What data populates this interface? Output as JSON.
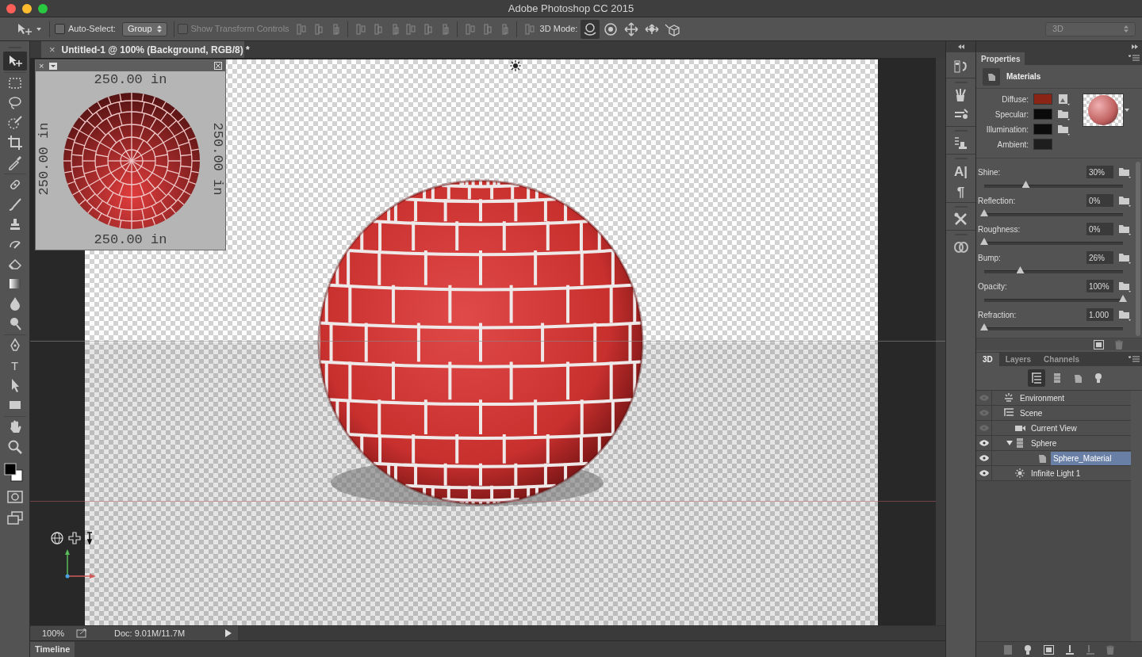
{
  "window": {
    "title": "Adobe Photoshop CC 2015"
  },
  "options_bar": {
    "auto_select": {
      "label": "Auto-Select:",
      "checked": false
    },
    "group_dropdown": {
      "value": "Group"
    },
    "show_transform": {
      "label": "Show Transform Controls",
      "checked": false,
      "disabled": true
    },
    "mode_label": "3D Mode:",
    "mode_tools": [
      {
        "selected": true
      },
      {
        "selected": false
      },
      {
        "selected": false
      },
      {
        "selected": false
      },
      {
        "selected": false
      }
    ],
    "workspace": {
      "value": "3D"
    }
  },
  "document_tab": {
    "close": "×",
    "title": "Untitled-1 @ 100% (Background, RGB/8) *"
  },
  "tools": [
    {
      "selected": true
    },
    {
      "selected": false
    },
    {
      "selected": false
    },
    {
      "selected": false
    },
    {
      "selected": false
    },
    {
      "selected": false
    },
    {
      "selected": false
    },
    {
      "selected": false
    },
    {
      "selected": false
    },
    {
      "selected": false
    },
    {
      "selected": false
    },
    {
      "selected": false
    },
    {
      "selected": false
    },
    {
      "selected": false
    },
    {
      "selected": false
    },
    {
      "selected": false,
      "glyph": "T"
    },
    {
      "selected": false
    },
    {
      "selected": false
    },
    {
      "selected": false
    },
    {
      "selected": false
    }
  ],
  "uv_overlay": {
    "close": "×",
    "labels": [
      "250.00 in",
      "250.00 in",
      "250.00 in",
      "250.00 in"
    ]
  },
  "status_bar": {
    "zoom": "100%",
    "doc": "Doc: 9.01M/11.7M"
  },
  "timeline": {
    "label": "Timeline"
  },
  "icon_strip": [
    "A|",
    "¶"
  ],
  "properties": {
    "tab": "Properties",
    "section": "Materials",
    "swatches": [
      {
        "label": "Diffuse:",
        "color": "#8a2516",
        "kind": "texture"
      },
      {
        "label": "Specular:",
        "color": "#0a0a0a",
        "kind": "folder"
      },
      {
        "label": "Illumination:",
        "color": "#0c0c0c",
        "kind": "folder"
      },
      {
        "label": "Ambient:",
        "color": "#1e1e1e",
        "kind": "plain"
      }
    ],
    "sliders": [
      {
        "label": "Shine:",
        "value": "30%",
        "level": 0.3
      },
      {
        "label": "Reflection:",
        "value": "0%",
        "level": 0
      },
      {
        "label": "Roughness:",
        "value": "0%",
        "level": 0
      },
      {
        "label": "Bump:",
        "value": "26%",
        "level": 0.26
      },
      {
        "label": "Opacity:",
        "value": "100%",
        "level": 1
      },
      {
        "label": "Refraction:",
        "value": "1.000",
        "level": 0
      }
    ]
  },
  "scene_panel": {
    "tabs": [
      {
        "label": "3D",
        "selected": true
      },
      {
        "label": "Layers",
        "selected": false
      },
      {
        "label": "Channels",
        "selected": false
      }
    ],
    "filters": [
      {
        "selected": true
      },
      {
        "selected": false
      },
      {
        "selected": false
      },
      {
        "selected": false
      }
    ],
    "items": [
      {
        "label": "Environment",
        "kind": "environment",
        "visible": false,
        "selected": false
      },
      {
        "label": "Scene",
        "kind": "scene",
        "visible": false,
        "selected": false,
        "children": [
          {
            "label": "Current View",
            "kind": "camera",
            "visible": false,
            "selected": false
          },
          {
            "label": "Sphere",
            "kind": "mesh",
            "visible": true,
            "selected": false,
            "expanded": true,
            "children": [
              {
                "label": "Sphere_Material",
                "kind": "material",
                "visible": true,
                "selected": true
              }
            ]
          },
          {
            "label": "Infinite Light 1",
            "kind": "light",
            "visible": true,
            "selected": false
          }
        ]
      }
    ]
  }
}
